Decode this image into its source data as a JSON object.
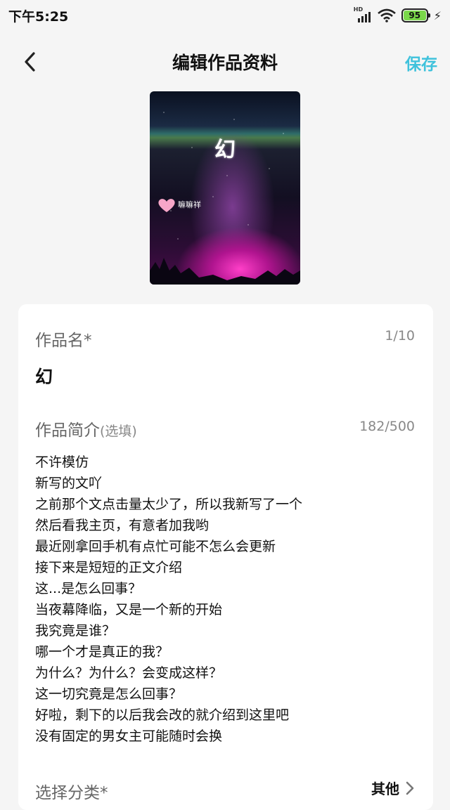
{
  "status": {
    "time": "下午5:25",
    "network": "HD",
    "battery": "95"
  },
  "nav": {
    "title": "编辑作品资料",
    "save_label": "保存"
  },
  "cover": {
    "title": "幻",
    "author_mark": "嘛嘛祥"
  },
  "form": {
    "name_label": "作品名*",
    "name_counter": "1/10",
    "name_value": "幻",
    "intro_label": "作品简介",
    "intro_optional": "(选填)",
    "intro_counter": "182/500",
    "intro_lines": [
      "不许模仿",
      "新写的文吖",
      "之前那个文点击量太少了，所以我新写了一个",
      "然后看我主页，有意者加我哟",
      "最近刚拿回手机有点忙可能不怎么会更新",
      "接下来是短短的正文介绍",
      "这...是怎么回事？",
      "当夜幕降临，又是一个新的开始",
      "我究竟是谁？",
      "哪一个才是真正的我？",
      "为什么？为什么？会变成这样？",
      "这一切究竟是怎么回事？",
      "好啦，剩下的以后我会改的就介绍到这里吧",
      "没有固定的男女主可能随时会换"
    ],
    "category_label": "选择分类*",
    "category_value": "其他"
  },
  "colors": {
    "accent": "#3fc2dc",
    "battery": "#7ad84a",
    "background": "#f5f5f5"
  }
}
